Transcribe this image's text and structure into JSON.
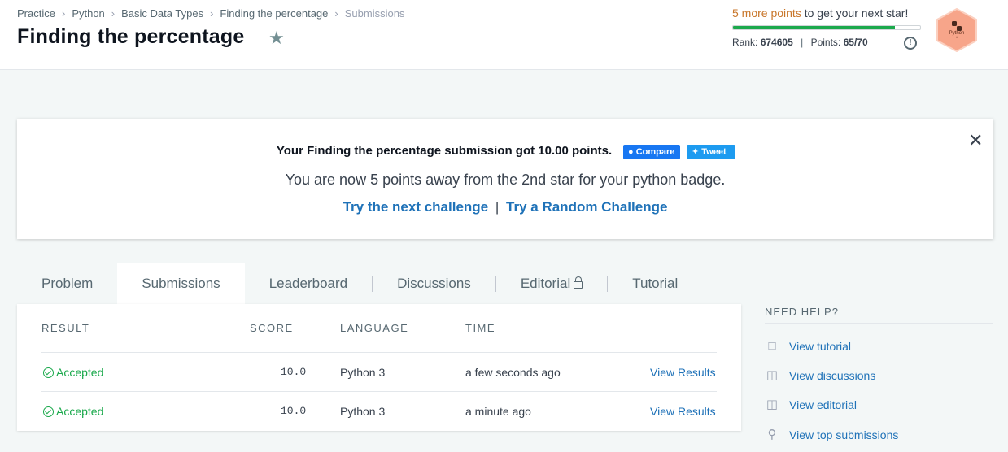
{
  "breadcrumb": [
    "Practice",
    "Python",
    "Basic Data Types",
    "Finding the percentage",
    "Submissions"
  ],
  "page_title": "Finding the percentage",
  "progress": {
    "highlight": "5 more points",
    "rest": " to get your next star!",
    "rank_label": "Rank:",
    "rank_value": "674605",
    "points_label": "Points:",
    "points_value": "65/70",
    "fraction": 0.867
  },
  "badge": {
    "label": "Python",
    "color": "#f7a58a",
    "dot": "•"
  },
  "notice": {
    "line1": "Your Finding the percentage submission got 10.00 points.",
    "compare": "Compare",
    "tweet": "Tweet",
    "line2": "You are now 5 points away from the 2nd star for your python badge.",
    "link1": "Try the next challenge",
    "sep": "|",
    "link2": "Try a Random Challenge",
    "close": "✕"
  },
  "tabs": [
    "Problem",
    "Submissions",
    "Leaderboard",
    "Discussions",
    "Editorial",
    "Tutorial"
  ],
  "table": {
    "headers": [
      "RESULT",
      "SCORE",
      "LANGUAGE",
      "TIME"
    ],
    "rows": [
      {
        "result": "Accepted",
        "score": "10.0",
        "language": "Python 3",
        "time": "a few seconds ago",
        "action": "View Results"
      },
      {
        "result": "Accepted",
        "score": "10.0",
        "language": "Python 3",
        "time": "a minute ago",
        "action": "View Results"
      }
    ]
  },
  "help": {
    "title": "NEED HELP?",
    "items": [
      "View tutorial",
      "View discussions",
      "View editorial",
      "View top submissions"
    ]
  },
  "colors": {
    "accent": "#1f72b8",
    "success": "#1ba94c",
    "orange": "#c8762a"
  }
}
